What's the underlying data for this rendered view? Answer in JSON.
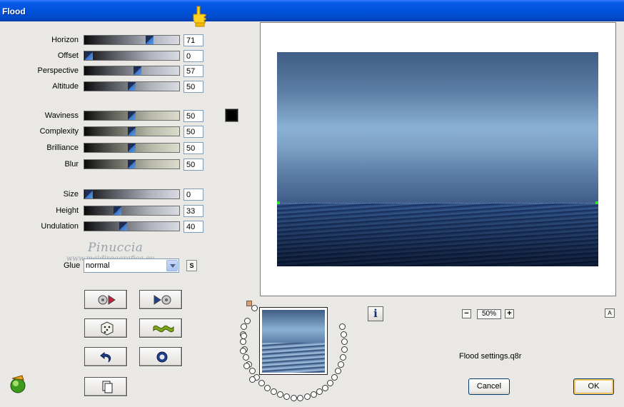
{
  "window": {
    "title": "Flood"
  },
  "colors": {
    "title_bar": "#0052dc",
    "color_swatch": "#000000"
  },
  "sliders": [
    {
      "label": "Horizon",
      "value": "71",
      "fraction": 0.71,
      "style": "blue"
    },
    {
      "label": "Offset",
      "value": "0",
      "fraction": 0.0,
      "style": "blue"
    },
    {
      "label": "Perspective",
      "value": "57",
      "fraction": 0.57,
      "style": "blue"
    },
    {
      "label": "Altitude",
      "value": "50",
      "fraction": 0.5,
      "style": "blue"
    },
    {
      "label": "Waviness",
      "value": "50",
      "fraction": 0.5,
      "style": "olive"
    },
    {
      "label": "Complexity",
      "value": "50",
      "fraction": 0.5,
      "style": "olive"
    },
    {
      "label": "Brilliance",
      "value": "50",
      "fraction": 0.5,
      "style": "olive"
    },
    {
      "label": "Blur",
      "value": "50",
      "fraction": 0.5,
      "style": "olive"
    },
    {
      "label": "Size",
      "value": "0",
      "fraction": 0.0,
      "style": "blue"
    },
    {
      "label": "Height",
      "value": "33",
      "fraction": 0.33,
      "style": "blue"
    },
    {
      "label": "Undulation",
      "value": "40",
      "fraction": 0.4,
      "style": "blue"
    }
  ],
  "watermark": {
    "name": "Pinuccia",
    "site": "www.maidireagrafica.eu"
  },
  "glue": {
    "label": "Glue",
    "value": "normal",
    "s_button": "S"
  },
  "icons": {
    "pointer": "pointing-hand-icon",
    "filter_logo": "filter-logo-icon",
    "buttons": [
      "reset-left-icon",
      "reset-right-icon",
      "random-dice-icon",
      "wave-preset-icon",
      "undo-icon",
      "target-icon",
      "copy-icon"
    ]
  },
  "preview": {
    "zoom": "50%",
    "zoom_out": "−",
    "zoom_in": "+",
    "a_button": "A",
    "info_button": "i"
  },
  "settings_file": "Flood settings.q8r",
  "buttons": {
    "cancel": "Cancel",
    "ok": "OK"
  }
}
